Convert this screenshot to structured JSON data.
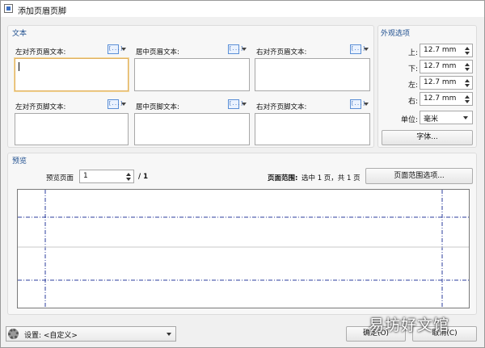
{
  "window": {
    "title": "添加页眉页脚"
  },
  "text_group": {
    "label": "文本",
    "header_left_label": "左对齐页眉文本:",
    "header_center_label": "居中页眉文本:",
    "header_right_label": "右对齐页眉文本:",
    "footer_left_label": "左对齐页脚文本:",
    "footer_center_label": "居中页脚文本:",
    "footer_right_label": "右对齐页脚文本:",
    "macro_icon": "[...]"
  },
  "appearance": {
    "label": "外观选项",
    "top_label": "上:",
    "bottom_label": "下:",
    "left_label": "左:",
    "right_label": "右:",
    "top_value": "12.7 mm",
    "bottom_value": "12.7 mm",
    "left_value": "12.7 mm",
    "right_value": "12.7 mm",
    "unit_label": "单位:",
    "unit_value": "毫米",
    "font_button": "字体..."
  },
  "preview": {
    "label": "预览",
    "page_label": "预览页面",
    "page_value": "1",
    "page_total": "/ 1",
    "range_label": "页面范围:",
    "range_text": "选中 1 页，共 1 页",
    "range_button": "页面范围选项..."
  },
  "footer": {
    "settings_label": "设置: <自定义>",
    "ok_button": "确定(O)",
    "cancel_button": "取消(C)"
  },
  "watermark": "易坊好文馆"
}
